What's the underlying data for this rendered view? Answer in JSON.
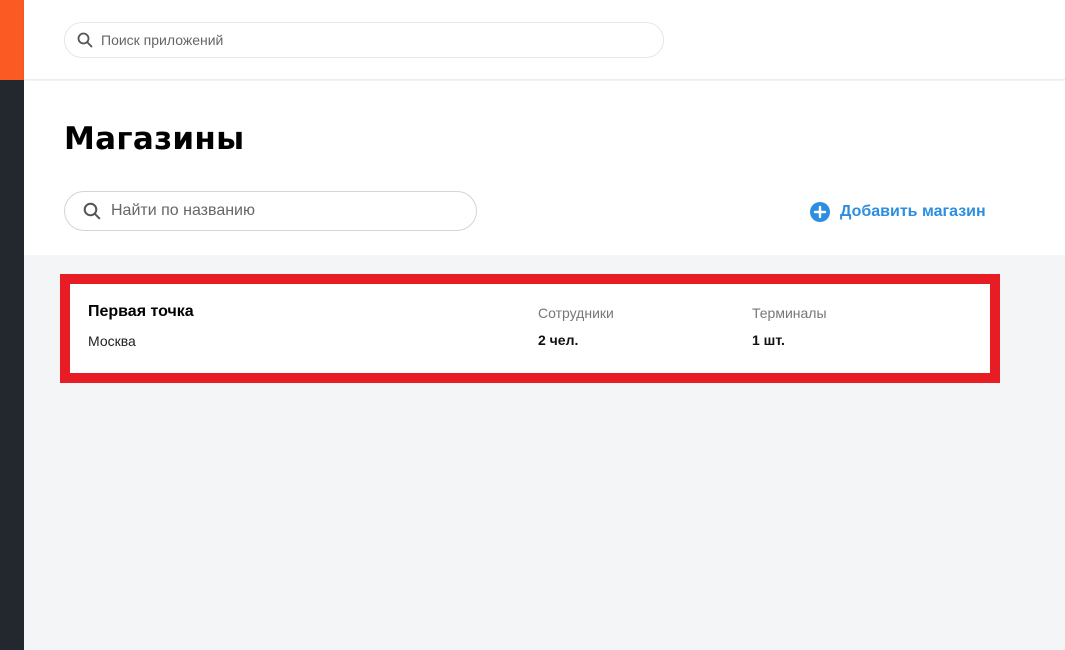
{
  "topbar": {
    "app_search": {
      "placeholder": "Поиск приложений",
      "value": ""
    }
  },
  "header": {
    "title": "Магазины",
    "name_search": {
      "placeholder": "Найти по названию",
      "value": ""
    },
    "add_store_label": "Добавить магазин"
  },
  "stores": [
    {
      "name": "Первая точка",
      "city": "Москва",
      "employees_label": "Сотрудники",
      "employees_value": "2 чел.",
      "terminals_label": "Терминалы",
      "terminals_value": "1 шт."
    }
  ],
  "icons": {
    "app_search": "search-icon",
    "name_search": "search-icon",
    "add_store": "plus-circle-icon"
  },
  "colors": {
    "brand_orange": "#fc5a23",
    "rail_dark": "#23272e",
    "accent_blue": "#2c8ee0",
    "highlight_red": "#e81c24",
    "content_bg": "#f4f5f7"
  }
}
